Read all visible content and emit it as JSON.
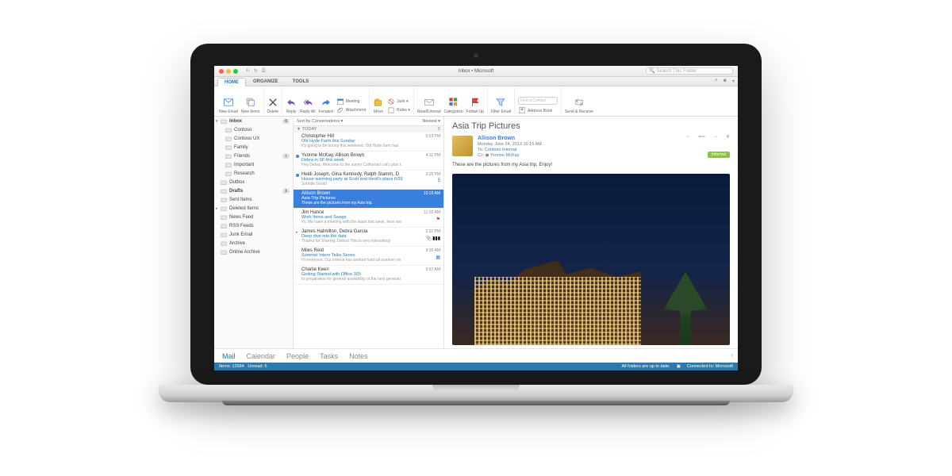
{
  "titlebar": {
    "title": "Inbox • Microsoft",
    "search_placeholder": "Search This Folder"
  },
  "tabs": {
    "items": [
      "HOME",
      "ORGANIZE",
      "TOOLS"
    ],
    "active": 0
  },
  "ribbon": {
    "new_email": "New Email",
    "new_items": "New Items",
    "delete": "Delete",
    "reply": "Reply",
    "reply_all": "Reply All",
    "forward": "Forward",
    "meeting": "Meeting",
    "attachment": "Attachment",
    "move": "Move",
    "rules": "Rules ▾",
    "junk": "Junk ▾",
    "read_unread": "Read/Unread",
    "categorize": "Categorize",
    "follow_up": "Follow Up",
    "filter": "Filter Email",
    "find_contact": "Find a Contact",
    "address_book": "Address Book",
    "send_receive": "Send & Receive"
  },
  "sidebar": {
    "items": [
      {
        "label": "Inbox",
        "count": "6",
        "bold": true,
        "l": 1,
        "tri": "▾"
      },
      {
        "label": "Contoso",
        "l": 2
      },
      {
        "label": "Contoso UX",
        "l": 2
      },
      {
        "label": "Family",
        "l": 2
      },
      {
        "label": "Friends",
        "count": "1",
        "l": 2
      },
      {
        "label": "Important",
        "l": 2
      },
      {
        "label": "Research",
        "l": 2
      },
      {
        "label": "Outbox",
        "l": 1
      },
      {
        "label": "Drafts",
        "count": "1",
        "l": 1,
        "bold": true
      },
      {
        "label": "Sent Items",
        "l": 1
      },
      {
        "label": "Deleted Items",
        "l": 1,
        "tri": "▸"
      },
      {
        "label": "News Feed",
        "l": 1
      },
      {
        "label": "RSS Feeds",
        "l": 1
      },
      {
        "label": "Junk Email",
        "l": 1
      },
      {
        "label": "Archive",
        "l": 1
      },
      {
        "label": "Online Archive",
        "l": 1
      }
    ]
  },
  "list": {
    "sort_label": "Sort by Conversations ▾",
    "newest_label": "Newest ▾",
    "today": "TODAY",
    "today_count": "5",
    "messages": [
      {
        "from": "Christopher Hill",
        "subj": "Old Hyde Farm this Sunday",
        "prev": "It's going to be sunny this weekend. Old Hyde farm has",
        "time": "5:03 PM"
      },
      {
        "from": "Yvonne McKay, Allison Brown",
        "subj": "Debra in SF this week",
        "prev": "Hey Debra, Welcome to the sunny California! Let's plan t",
        "time": "4:11 PM",
        "unread": true,
        "thread": true
      },
      {
        "from": "Heidi Joseph, Gina Kennedy, Ralph Stamm, D",
        "subj": "House warming party at Scott and Heidi's place 6/29",
        "prev": "Sounds Good!",
        "time": "3:28 PM",
        "unread": true,
        "cnt": "5",
        "thread": true
      },
      {
        "from": "Allison Brown",
        "subj": "Asia Trip Pictures",
        "prev": "These are the pictures from my Asia trip.",
        "time": "10:15 AM",
        "selected": true
      },
      {
        "from": "Jim Hance",
        "subj": "Work Items and Swags",
        "prev": "Hi, We have a meeting with the leads last week, here are",
        "time": "11:52 AM",
        "flag": true
      },
      {
        "from": "James Halmilton, Debra Garcia",
        "subj": "Deep dive into the data",
        "prev": "Thanks for Sharing, Debra! This is very interesting!",
        "time": "2:32 PM",
        "attach": true,
        "flags3": true,
        "thread": true
      },
      {
        "from": "Miles Reid",
        "subj": "Summer Intern Talks Series",
        "prev": "Hi everyone, Our interns has worked hard all summer on",
        "time": "9:30 AM",
        "cal": true
      },
      {
        "from": "Charlie Keen",
        "subj": "Getting Started with Office 365",
        "prev": "In preparation for general availability of the next generati",
        "time": "9:07 AM"
      }
    ]
  },
  "reading": {
    "title": "Asia Trip Pictures",
    "sender": "Allison Brown",
    "date": "Monday June 24, 2013 10:15 AM",
    "to_label": "To:",
    "to": "Contoso Internal",
    "cc_label": "Cc:",
    "cc": "Yvonne McKay",
    "badge": "Informal",
    "body": "These are the pictures from my Asia trip.   Enjoy!"
  },
  "modules": [
    "Mail",
    "Calendar",
    "People",
    "Tasks",
    "Notes"
  ],
  "status": {
    "items": "Items: 12684",
    "unread": "Unread: 5",
    "uptodate": "All folders are up to date.",
    "connected": "Connected to: Microsoft"
  }
}
